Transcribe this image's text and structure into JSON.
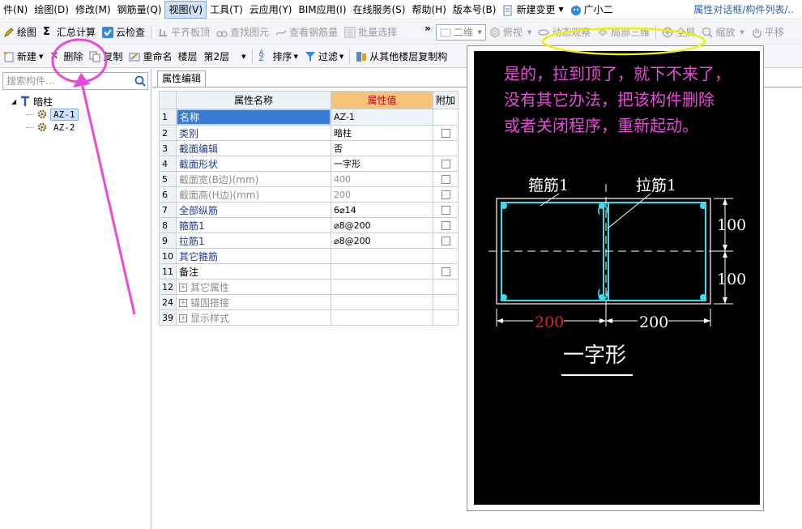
{
  "menu": {
    "items": [
      "件(N)",
      "绘图(D)",
      "修改(M)",
      "钢筋量(Q)",
      "视图(V)",
      "工具(T)",
      "云应用(Y)",
      "BIM应用(I)",
      "在线服务(S)",
      "帮助(H)",
      "版本号(B)",
      "新建变更",
      "广小二"
    ],
    "active_index": 4,
    "right_text": "属性对话框/构件列表/.."
  },
  "toolbar1": {
    "items": [
      "绘图",
      "汇总计算",
      "云检查",
      "平齐板顶",
      "查找图元",
      "查看钢筋量",
      "批量选择"
    ],
    "view_mode": "二维",
    "right_items": [
      "俯视",
      "动态观察",
      "局部三维",
      "全屏",
      "缩放",
      "平移"
    ]
  },
  "toolbar2": {
    "new": "新建",
    "delete": "删除",
    "copy": "复制",
    "rename": "重命名",
    "floor_label": "楼层",
    "floor_value": "第2层",
    "sort": "排序",
    "filter": "过滤",
    "copy_from": "从其他楼层复制构"
  },
  "left": {
    "search_placeholder": "搜索构件...",
    "tree_root": "暗柱",
    "tree_children": [
      "AZ-1",
      "AZ-2"
    ]
  },
  "panel": {
    "tab": "属性编辑",
    "col_name": "属性名称",
    "col_value": "属性值",
    "col_extra": "附加"
  },
  "rows": [
    {
      "num": "1",
      "name": "名称",
      "value": "AZ-1",
      "cb": false,
      "style": "selected"
    },
    {
      "num": "2",
      "name": "类别",
      "value": "暗柱",
      "cb": true,
      "style": "normal"
    },
    {
      "num": "3",
      "name": "截面编辑",
      "value": "否",
      "cb": false,
      "style": "normal"
    },
    {
      "num": "4",
      "name": "截面形状",
      "value": "一字形",
      "cb": true,
      "style": "normal"
    },
    {
      "num": "5",
      "name": "截面宽(B边)(mm)",
      "value": "400",
      "cb": true,
      "style": "gray"
    },
    {
      "num": "6",
      "name": "截面高(H边)(mm)",
      "value": "200",
      "cb": true,
      "style": "gray"
    },
    {
      "num": "7",
      "name": "全部纵筋",
      "value": "6⌀14",
      "cb": true,
      "style": "normal"
    },
    {
      "num": "8",
      "name": "箍筋1",
      "value": "⌀8@200",
      "cb": true,
      "style": "normal"
    },
    {
      "num": "9",
      "name": "拉筋1",
      "value": "⌀8@200",
      "cb": true,
      "style": "normal"
    },
    {
      "num": "10",
      "name": "其它箍筋",
      "value": "",
      "cb": false,
      "style": "normal"
    },
    {
      "num": "11",
      "name": "备注",
      "value": "",
      "cb": true,
      "style": "black"
    },
    {
      "num": "12",
      "name": "其它属性",
      "value": "",
      "cb": false,
      "style": "group"
    },
    {
      "num": "24",
      "name": "锚固搭接",
      "value": "",
      "cb": false,
      "style": "group"
    },
    {
      "num": "39",
      "name": "显示样式",
      "value": "",
      "cb": false,
      "style": "group"
    }
  ],
  "overlay": {
    "message": [
      "是的，拉到顶了，就下不来了，",
      "没有其它办法，把该构件删除",
      "或者关闭程序，重新起动。"
    ],
    "label_stirrup": "箍筋1",
    "label_tie": "拉筋1",
    "dim_height_top": "100",
    "dim_height_bottom": "100",
    "dim_width_left": "200",
    "dim_width_right": "200",
    "shape_name": "一字形"
  },
  "colors": {
    "magenta": "#e84bd9",
    "yellow": "#f2f000",
    "cyan": "#32e0ee",
    "accent": "#3a7bd5"
  }
}
